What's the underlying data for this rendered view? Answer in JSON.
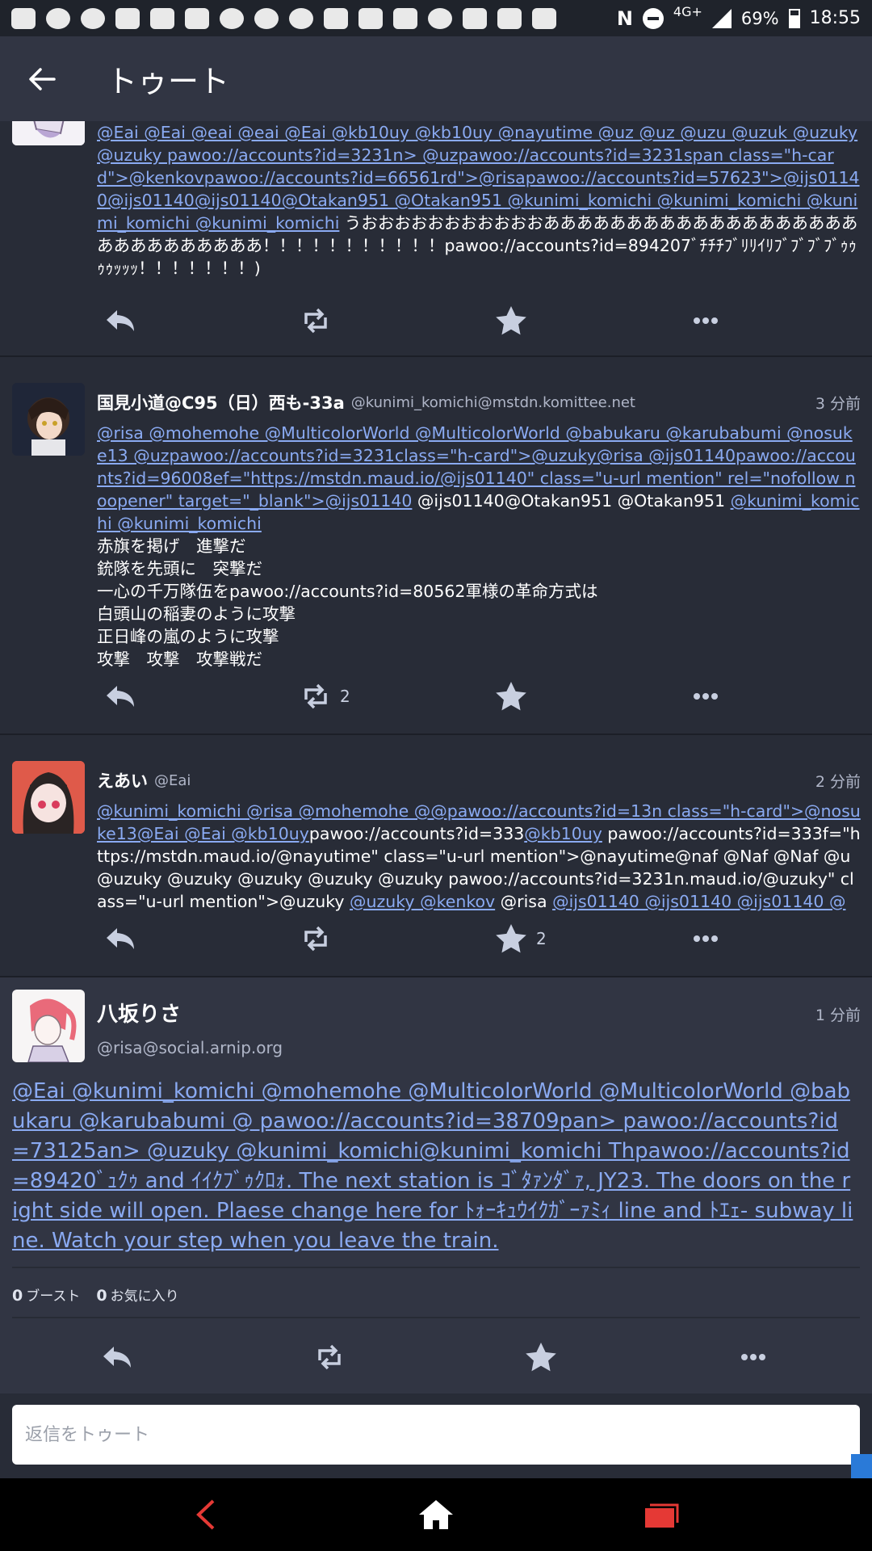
{
  "status_bar": {
    "time": "18:55",
    "battery": "69%",
    "network": "4G+",
    "nfc": "N"
  },
  "app_bar": {
    "title": "トゥート"
  },
  "statuses": [
    {
      "content_lines": [
        "@Eai @Eai @eai @eai @Eai @kb10uy @kb10uy @nayutime @uz @uz @uzu @uzuk @uzuky @uzuky pawoo://accounts?id=3231n> @uzpawoo://accounts?id=3231span class=\"h-card\">@kenkovpawoo://accounts?id=66561rd\">@risapawoo://accounts?id=57623\">@ijs01140@ijs01140@ijs01140@Otakan951 @Otakan951 @kunimi_komichi @kunimi_komichi @kunimi_komichi @kunimi_komichi"
      ],
      "content_plain": "うおおおおおおおおおおおあああああああああああああああああああああああああああああ！！！！！！！！！！！pawoo://accounts?id=894207ﾞﾁﾁﾁﾌﾞﾘﾘｲﾘﾌﾞﾌﾞﾌﾞﾌﾞｩｩｩｩｯｯｯ！！！！！！！)",
      "boosts": "",
      "favourites": ""
    },
    {
      "display_name": "国見小道@C95（日）西も-33a",
      "acct": "@kunimi_komichi@mstdn.komittee.net",
      "time": "3 分前",
      "links": "@risa @mohemohe @MulticolorWorld @MulticolorWorld @babukaru @karubabumi @nosuke13 @uzpawoo://accounts?id=3231class=\"h-card\">@uzuky@risa @ijs01140pawoo://accounts?id=96008ef=\"https://mstdn.maud.io/@ijs01140\" class=\"u-url mention\" rel=\"nofollow noopener\" target=\"_blank\">@ijs01140",
      "plain_mid": " @ijs01140@Otakan951 @Otakan951 ",
      "links_tail": "@kunimi_komichi @kunimi_komichi",
      "lines": [
        "赤旗を掲げ　進撃だ",
        "銃隊を先頭に　突撃だ",
        "一心の千万隊伍をpawoo://accounts?id=80562軍様の革命方式は",
        "白頭山の稲妻のように攻撃",
        "正日峰の嵐のように攻撃",
        "攻撃　攻撃　攻撃戦だ"
      ],
      "boosts": "2",
      "favourites": ""
    },
    {
      "display_name": "えあい",
      "acct": "@Eai",
      "time": "2 分前",
      "seg1": "@kunimi_komichi @risa @mohemohe @@pawoo://accounts?id=13n class=\"h-card\">@nosuke13@Eai @Eai @kb10uy",
      "seg2": "pawoo://accounts?id=333",
      "seg3": "@kb10uy",
      "seg4": " pawoo://accounts?id=333f=\"https://mstdn.maud.io/@nayutime\" class=\"u-url mention\">@nayutime@naf @Naf @Naf @u @uzuky @uzuky @uzuky @uzuky @uzuky pawoo://accounts?id=3231n.maud.io/@uzuky\" class=\"u-url mention\">@uzuky ",
      "seg5": "@uzuky @kenkov",
      "seg6": " @risa ",
      "seg7": "@ijs01140 @ijs01140 @ijs01140 @",
      "boosts": "",
      "favourites": "2"
    }
  ],
  "focused": {
    "display_name": "八坂りさ",
    "acct": "@risa@social.arnip.org",
    "time": "1 分前",
    "content": "@Eai @kunimi_komichi @mohemohe @MulticolorWorld @MulticolorWorld @babukaru @karubabumi @ pawoo://accounts?id=38709pan> pawoo://accounts?id=73125an> @uzuky @kunimi_komichi@kunimi_komichi Thpawoo://accounts?id=89420ﾞｭｸｩ and ｲｲｸﾌﾞｩｸﾛｫ. The next station is ｺﾞﾀｧﾝﾀﾞｧ, JY23. The doors on the right side will open. Plaese change here for ﾄｫｰｷｭｳｲｸｶﾞｰｧﾐｨ line and ﾄｴｪ- subway line. Watch your step when you leave the train.",
    "boost_count": "0",
    "boost_label": "ブースト",
    "fav_count": "0",
    "fav_label": "お気に入り"
  },
  "composer": {
    "placeholder": "返信をトゥート"
  },
  "colors": {
    "background": "#282c37",
    "app_bar": "#313543",
    "link": "#8aaaf2",
    "nav_back": "#e53935",
    "nav_recents": "#e53935"
  }
}
